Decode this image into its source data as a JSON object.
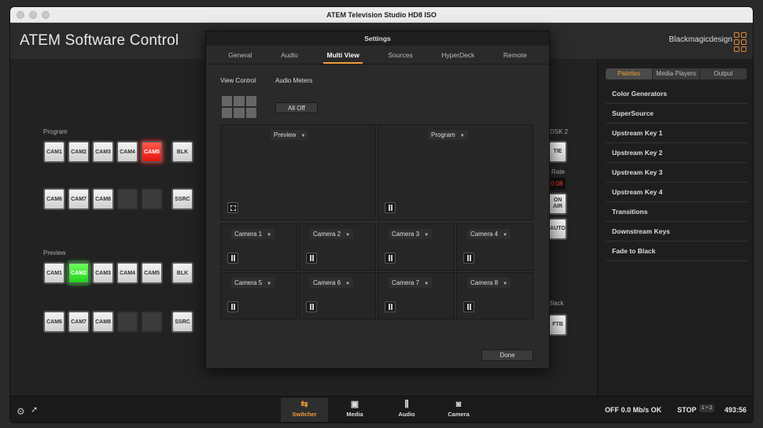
{
  "window": {
    "title": "ATEM Television Studio HD8 ISO"
  },
  "app": {
    "title": "ATEM Software Control",
    "brand": "Blackmagicdesign"
  },
  "switcher": {
    "program_label": "Program",
    "preview_label": "Preview",
    "row1": [
      "CAM1",
      "CAM2",
      "CAM3",
      "CAM4",
      "CAM5",
      "BLK"
    ],
    "row2": [
      "CAM6",
      "CAM7",
      "CAM8",
      "",
      "",
      "SSRC"
    ],
    "program_active": "CAM5",
    "preview_active": "CAM2",
    "dsk_label": "DSK 2",
    "tie": "TIE",
    "rate_label": "Rate",
    "rate_value": "0:08",
    "on_air": "ON AIR",
    "auto": "AUTO",
    "black_label": "Black",
    "ftb": "FTB",
    "colors": {
      "program": "#e3140d",
      "preview": "#20d21a",
      "accent": "#f29b3a"
    }
  },
  "sidebar": {
    "tabs": [
      {
        "label": "Palettes",
        "active": true
      },
      {
        "label": "Media Players",
        "active": false
      },
      {
        "label": "Output",
        "active": false
      }
    ],
    "items": [
      "Color Generators",
      "SuperSource",
      "Upstream Key 1",
      "Upstream Key 2",
      "Upstream Key 3",
      "Upstream Key 4",
      "Transitions",
      "Downstream Keys",
      "Fade to Black"
    ]
  },
  "bottom": {
    "nav": [
      {
        "label": "Switcher",
        "icon": "switcher-icon",
        "active": true
      },
      {
        "label": "Media",
        "icon": "media-icon",
        "active": false
      },
      {
        "label": "Audio",
        "icon": "audio-icon",
        "active": false
      },
      {
        "label": "Camera",
        "icon": "camera-icon",
        "active": false
      }
    ],
    "stream_status": "OFF  0.0 Mb/s  OK",
    "record_status": "STOP",
    "record_box": "1 ÷ 2",
    "timecode": "493:56"
  },
  "settings": {
    "title": "Settings",
    "tabs": [
      {
        "label": "General",
        "active": false
      },
      {
        "label": "Audio",
        "active": false
      },
      {
        "label": "Multi View",
        "active": true
      },
      {
        "label": "Sources",
        "active": false
      },
      {
        "label": "HyperDeck",
        "active": false
      },
      {
        "label": "Remote",
        "active": false
      }
    ],
    "view_control_label": "View Control",
    "audio_meters_label": "Audio Meters",
    "audio_meters_value": "All Off",
    "large_views": [
      "Preview",
      "Program"
    ],
    "small_views": [
      "Camera 1",
      "Camera 2",
      "Camera 3",
      "Camera 4",
      "Camera 5",
      "Camera 6",
      "Camera 7",
      "Camera 8"
    ],
    "done_label": "Done"
  }
}
